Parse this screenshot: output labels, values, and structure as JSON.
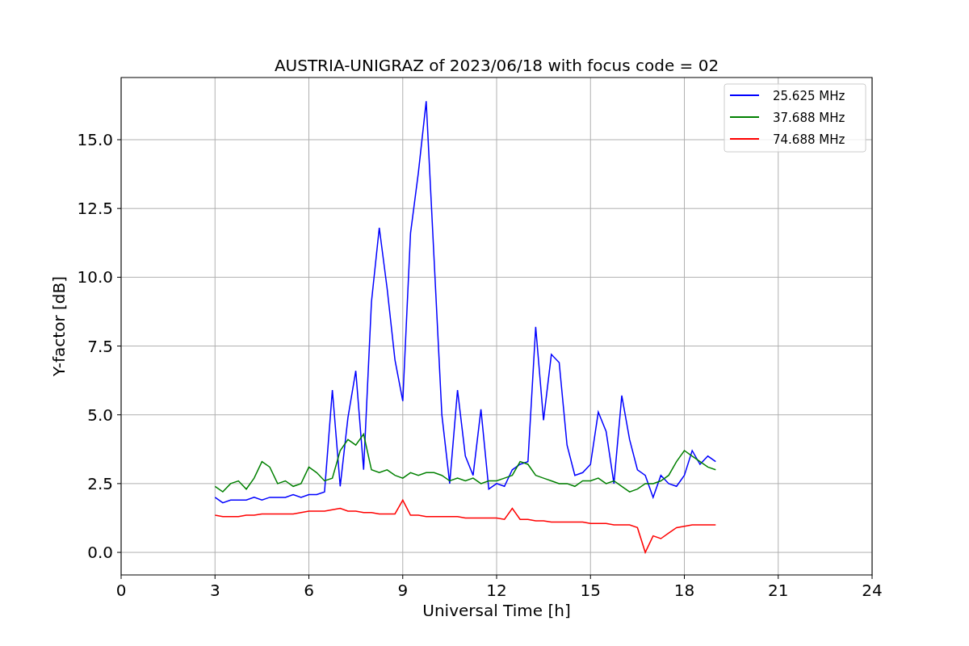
{
  "figure": {
    "chart_data": {
      "type": "line",
      "title": "AUSTRIA-UNIGRAZ of 2023/06/18 with focus code = 02",
      "xlabel": "Universal Time [h]",
      "ylabel": "Y-factor [dB]",
      "x": [
        3,
        3.25,
        3.5,
        3.75,
        4,
        4.25,
        4.5,
        4.75,
        5,
        5.25,
        5.5,
        5.75,
        6,
        6.25,
        6.5,
        6.75,
        7,
        7.25,
        7.5,
        7.75,
        8,
        8.25,
        8.5,
        8.75,
        9,
        9.25,
        9.5,
        9.75,
        10,
        10.25,
        10.5,
        10.75,
        11,
        11.25,
        11.5,
        11.75,
        12,
        12.25,
        12.5,
        12.75,
        13,
        13.25,
        13.5,
        13.75,
        14,
        14.25,
        14.5,
        14.75,
        15,
        15.25,
        15.5,
        15.75,
        16,
        16.25,
        16.5,
        16.75,
        17,
        17.25,
        17.5,
        17.75,
        18,
        18.25,
        18.5,
        18.75,
        19
      ],
      "series": [
        {
          "name": "25.625 MHz",
          "color": "#0000ff",
          "values": [
            2.0,
            1.8,
            1.9,
            1.9,
            1.9,
            2.0,
            1.9,
            2.0,
            2.0,
            2.0,
            2.1,
            2.0,
            2.1,
            2.1,
            2.2,
            5.9,
            2.4,
            4.9,
            6.6,
            3.0,
            9.1,
            11.8,
            9.6,
            7.0,
            5.5,
            11.6,
            13.8,
            16.4,
            10.7,
            5.0,
            2.5,
            5.9,
            3.5,
            2.8,
            5.2,
            2.3,
            2.5,
            2.4,
            3.0,
            3.2,
            3.3,
            8.2,
            4.8,
            7.2,
            6.9,
            3.9,
            2.8,
            2.9,
            3.2,
            5.1,
            4.4,
            2.5,
            5.7,
            4.1,
            3.0,
            2.8,
            2.0,
            2.8,
            2.5,
            2.4,
            2.8,
            3.7,
            3.2,
            3.5,
            3.3
          ]
        },
        {
          "name": "37.688 MHz",
          "color": "#008000",
          "values": [
            2.4,
            2.2,
            2.5,
            2.6,
            2.3,
            2.7,
            3.3,
            3.1,
            2.5,
            2.6,
            2.4,
            2.5,
            3.1,
            2.9,
            2.6,
            2.7,
            3.7,
            4.1,
            3.9,
            4.3,
            3.0,
            2.9,
            3.0,
            2.8,
            2.7,
            2.9,
            2.8,
            2.9,
            2.9,
            2.8,
            2.6,
            2.7,
            2.6,
            2.7,
            2.5,
            2.6,
            2.6,
            2.7,
            2.8,
            3.3,
            3.2,
            2.8,
            2.7,
            2.6,
            2.5,
            2.5,
            2.4,
            2.6,
            2.6,
            2.7,
            2.5,
            2.6,
            2.4,
            2.2,
            2.3,
            2.5,
            2.5,
            2.6,
            2.8,
            3.3,
            3.7,
            3.5,
            3.3,
            3.1,
            3.0
          ]
        },
        {
          "name": "74.688 MHz",
          "color": "#ff0000",
          "values": [
            1.35,
            1.3,
            1.3,
            1.3,
            1.35,
            1.35,
            1.4,
            1.4,
            1.4,
            1.4,
            1.4,
            1.45,
            1.5,
            1.5,
            1.5,
            1.55,
            1.6,
            1.5,
            1.5,
            1.45,
            1.45,
            1.4,
            1.4,
            1.4,
            1.9,
            1.35,
            1.35,
            1.3,
            1.3,
            1.3,
            1.3,
            1.3,
            1.25,
            1.25,
            1.25,
            1.25,
            1.25,
            1.2,
            1.6,
            1.2,
            1.2,
            1.15,
            1.15,
            1.1,
            1.1,
            1.1,
            1.1,
            1.1,
            1.05,
            1.05,
            1.05,
            1.0,
            1.0,
            1.0,
            0.9,
            0.0,
            0.6,
            0.5,
            0.7,
            0.9,
            0.95,
            1.0,
            1.0,
            1.0,
            1.0
          ]
        }
      ],
      "grid": true,
      "legend": true,
      "xlim": [
        0,
        24
      ],
      "ylim": [
        -0.82,
        17.26
      ],
      "xticks": [
        0,
        3,
        6,
        9,
        12,
        15,
        18,
        21,
        24
      ],
      "yticks": [
        {
          "value": 0,
          "label": "0.0"
        },
        {
          "value": 2.5,
          "label": "2.5"
        },
        {
          "value": 5,
          "label": "5.0"
        },
        {
          "value": 7.5,
          "label": "7.5"
        },
        {
          "value": 10,
          "label": "10.0"
        },
        {
          "value": 12.5,
          "label": "12.5"
        },
        {
          "value": 15,
          "label": "15.0"
        }
      ]
    }
  }
}
